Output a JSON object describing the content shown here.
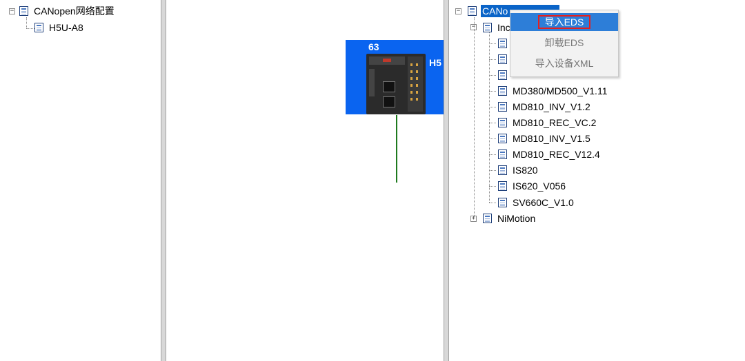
{
  "left_tree": {
    "root": {
      "label": "CANopen网络配置"
    },
    "child": {
      "label": "H5U-A8"
    }
  },
  "canvas": {
    "device": {
      "number": "63",
      "tag": "H5"
    }
  },
  "right_tree": {
    "root": {
      "label": "CANo"
    },
    "group1": {
      "label": "Inc"
    },
    "items": [
      {
        "label": ""
      },
      {
        "label": ""
      },
      {
        "label": ""
      },
      {
        "label": "MD380/MD500_V1.11"
      },
      {
        "label": "MD810_INV_V1.2"
      },
      {
        "label": "MD810_REC_VC.2"
      },
      {
        "label": "MD810_INV_V1.5"
      },
      {
        "label": "MD810_REC_V12.4"
      },
      {
        "label": "IS820"
      },
      {
        "label": "IS620_V056"
      },
      {
        "label": "SV660C_V1.0"
      }
    ],
    "group2": {
      "label": "NiMotion"
    }
  },
  "context_menu": {
    "items": [
      {
        "label": "导入EDS",
        "enabled": true
      },
      {
        "label": "卸载EDS",
        "enabled": false
      },
      {
        "label": "导入设备XML",
        "enabled": false
      }
    ]
  },
  "colors": {
    "selection": "#0a64c8",
    "device_bg": "#0a64f0",
    "bus_line": "#1e7a1e",
    "highlight_border": "#e32020"
  }
}
